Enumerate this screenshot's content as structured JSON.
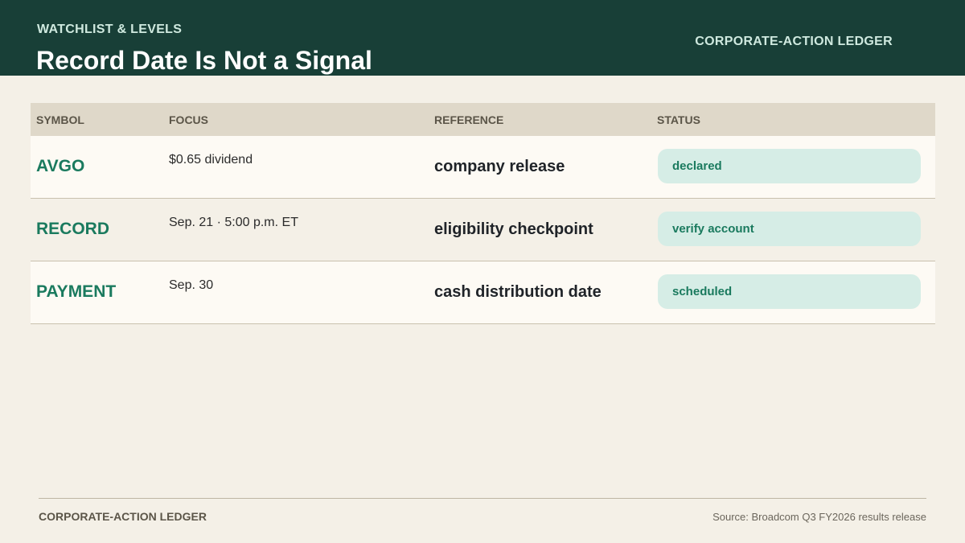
{
  "header": {
    "kicker": "WATCHLIST & LEVELS",
    "title": "Record Date Is Not a Signal",
    "brand": "CORPORATE-ACTION LEDGER"
  },
  "table": {
    "columns": [
      "SYMBOL",
      "FOCUS",
      "REFERENCE",
      "STATUS"
    ],
    "rows": [
      {
        "symbol": "AVGO",
        "focus": "$0.65 dividend",
        "reference": "company release",
        "status": "declared"
      },
      {
        "symbol": "RECORD",
        "focus": "Sep. 21 · 5:00 p.m. ET",
        "reference": "eligibility checkpoint",
        "status": "verify account"
      },
      {
        "symbol": "PAYMENT",
        "focus": "Sep. 30",
        "reference": "cash distribution date",
        "status": "scheduled"
      }
    ]
  },
  "footer": {
    "left": "CORPORATE-ACTION LEDGER",
    "source": "Source: Broadcom Q3 FY2026 results release"
  },
  "colors": {
    "header_bg": "#183f37",
    "accent": "#1a7a5e",
    "pill_bg": "#d6ede6",
    "page_bg": "#f4f0e7"
  }
}
